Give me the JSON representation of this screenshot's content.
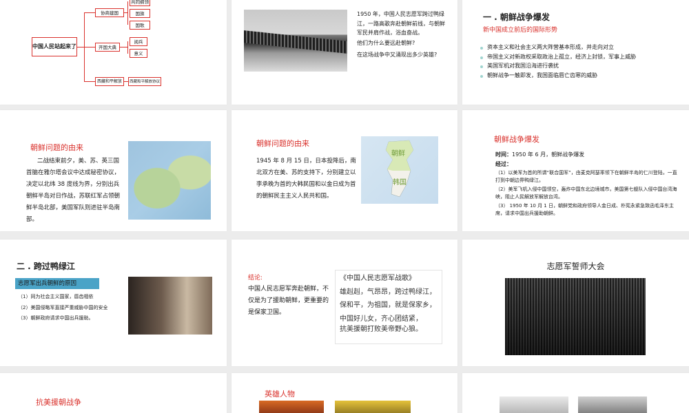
{
  "colors": {
    "accent": "#d9302b",
    "bullet": "#9fd4cf",
    "tag": "#4aa3c7"
  },
  "slide1": {
    "main": "中国人民站起来了",
    "branch1": "协商建国",
    "branch1_items": [
      "共同纲领",
      "国旗",
      "国歌"
    ],
    "branch2": "开国大典",
    "branch2_items": [
      "阅兵",
      "意义"
    ],
    "branch3": "西藏和平解放",
    "branch3_item": "西藏和平解放协议"
  },
  "slide2": {
    "text": "1950 年，中国人民志愿军跨过鸭绿江，一路高歌奔赴朝鲜前线，与朝鲜军民并肩作战，浴血奋战。",
    "q1": "他们为什么要远赴朝鲜?",
    "q2": "在这场战争中又涌现出多少英雄?"
  },
  "slide3": {
    "heading": "一 . 朝鲜战争爆发",
    "subheading": "新中国成立前后的国际形势",
    "bullets": [
      "资本主义和社会主义两大阵营基本形成，并走向对立",
      "帝国主义对新政权采取政治上孤立，经济上封锁，军事上威胁",
      "美国军机对我国沿海进行袭扰",
      "朝鲜战争一触即发，我国面临唇亡齿寒的威胁"
    ]
  },
  "slide4": {
    "title": "朝鲜问题的由来",
    "text": "二战结束前夕，美、苏、英三国首脑在雅尔塔会议中达成秘密协议，决定以北纬 38 度线为界，分别出兵朝鲜半岛对日作战，苏联红军占领朝鲜半岛北部，美国军队则进驻半岛南部。"
  },
  "slide5": {
    "title": "朝鲜问题的由来",
    "text": "1945 年 8 月 15 日，日本投降后，南北双方在美、苏的支持下，分别建立以李承晚为首的大韩民国和以金日成为首的朝鲜民主主义人民共和国。",
    "map_north": "朝鲜",
    "map_south": "韩国"
  },
  "slide6": {
    "title": "朝鲜战争爆发",
    "time_label": "时间：",
    "time_value": "1950 年 6 月，朝鲜战争爆发",
    "course_label": "经过：",
    "items": [
      "（1）以美军为首的所谓“联合国军”，由麦克阿瑟率领下在朝鲜半岛的仁川登陆，一直打到中朝边界鸭绿江。",
      "（2）美军飞机入侵中国领空，轰炸中国东北边境城市，美国第七舰队入侵中国台湾海峡，阻止人民解放军解放台湾。",
      "（3） 1950 年 10 月 1 日，朝鲜党和政府领导人金日成、朴宪永紧急致函毛泽东主席，请求中国出兵援助朝鲜。"
    ]
  },
  "slide7": {
    "heading": "二 . 跨过鸭绿江",
    "tag": "志愿军出兵朝鲜的原因",
    "items": [
      "（1）同为社会主义国家，唇齿相依",
      "（2）美国侵略军直接严重威胁中国的安全",
      "（3）朝鲜政府请求中国出兵援助。"
    ]
  },
  "slide8": {
    "label": "结论:",
    "text": "中国人民志愿军奔赴朝鲜，不仅是为了援助朝鲜，更重要的是保家卫国。",
    "poem_title": "《中国人民志愿军战歌》",
    "poem_lines": [
      "雄赳赳，气昂昂，跨过鸭绿江，",
      "保和平，为祖国，就是保家乡，",
      "中国好儿女，齐心团结紧，",
      "抗美援朝打败美帝野心狼。"
    ]
  },
  "slide9": {
    "title": "志愿军誓师大会"
  },
  "slide10": {
    "title": "抗美援朝战争"
  },
  "slide11": {
    "title": "英雄人物"
  }
}
